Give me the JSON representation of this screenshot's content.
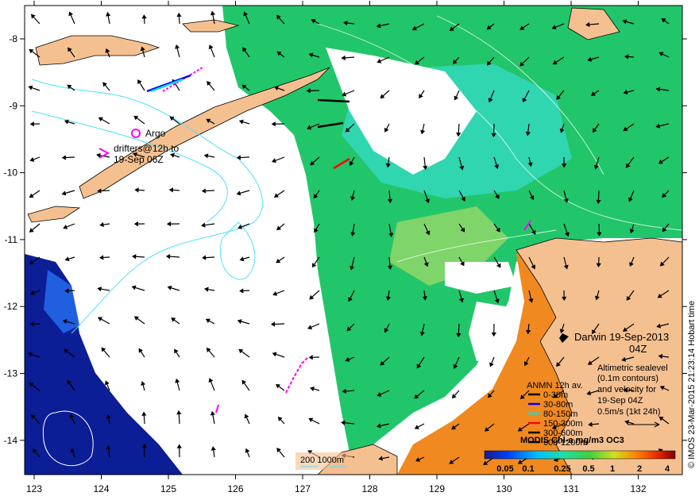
{
  "map": {
    "lon_ticks": [
      "123",
      "124",
      "125",
      "126",
      "127",
      "128",
      "129",
      "130",
      "131",
      "132"
    ],
    "lat_ticks": [
      "-8",
      "-9",
      "-10",
      "-11",
      "-12",
      "-13",
      "-14"
    ]
  },
  "legend_argo": {
    "argo_label": "Argo",
    "drifters_line1": "drifters@12h to",
    "drifters_line2": "19-Sep 06Z"
  },
  "title": {
    "place_date": "Darwin  19-Sep-2013",
    "time": "04Z"
  },
  "sealevel_note": {
    "line1": "Altimetric sealevel",
    "line2": "(0.1m contours)",
    "line3": "and velocity for",
    "line4": "19-Sep 04Z",
    "line5": "0.5m/s (1kt 24h)"
  },
  "anmn_legend": {
    "title": "ANMN 12h av.",
    "items": [
      {
        "label": "0-30m",
        "color": "#000000"
      },
      {
        "label": "30-80m",
        "color": "#0000ff"
      },
      {
        "label": "80-150m",
        "color": "#00e0e0"
      },
      {
        "label": "150-300m",
        "color": "#ff0000"
      },
      {
        "label": "300-600m",
        "color": "#000000"
      },
      {
        "label": "600-1200m",
        "color": "#000000"
      }
    ]
  },
  "colorbar": {
    "title": "MODIS Chl-a mg/m3 OC3",
    "ticks": [
      "0.05",
      "0.1",
      "0.25",
      "0.5",
      "1",
      "2",
      "4"
    ]
  },
  "depth_legend": {
    "label": "200  1000m"
  },
  "credit": "© IMOS 23-Mar-2015 21:23:14 Hobart time"
}
